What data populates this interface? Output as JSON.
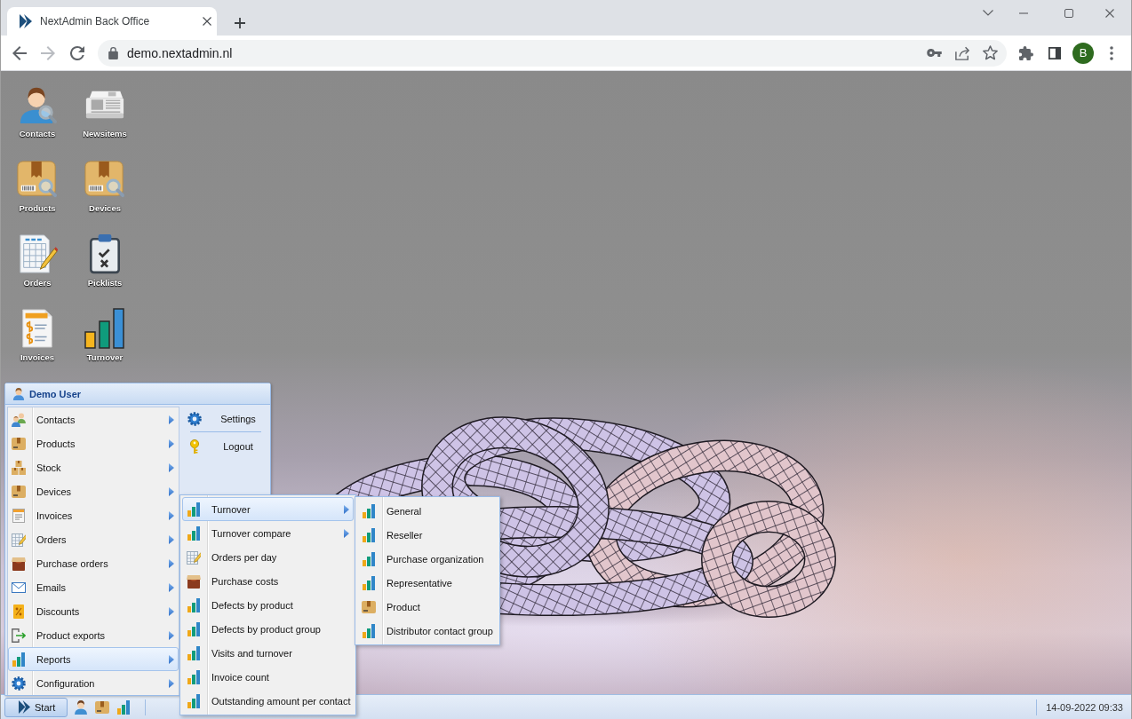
{
  "browser": {
    "tabs": [
      {
        "title": "NextAdmin Back Office",
        "selected": true
      }
    ],
    "navigation": {
      "back_disabled": false,
      "forward_disabled": true
    },
    "address": "demo.nextadmin.nl",
    "profile_initial": "B"
  },
  "desktop": {
    "shortcuts": [
      {
        "label": "Contacts",
        "kind": "contacts"
      },
      {
        "label": "Newsitems",
        "kind": "news"
      },
      {
        "label": "Products",
        "kind": "product"
      },
      {
        "label": "Devices",
        "kind": "product"
      },
      {
        "label": "Orders",
        "kind": "orders"
      },
      {
        "label": "Picklists",
        "kind": "picklist"
      },
      {
        "label": "Invoices",
        "kind": "invoice"
      },
      {
        "label": "Turnover",
        "kind": "chart"
      }
    ]
  },
  "start_menu": {
    "user": "Demo User",
    "items": [
      {
        "label": "Contacts",
        "kind": "contacts",
        "submenu": true,
        "selected": false
      },
      {
        "label": "Products",
        "kind": "box",
        "submenu": true,
        "selected": false
      },
      {
        "label": "Stock",
        "kind": "boxes",
        "submenu": true,
        "selected": false
      },
      {
        "label": "Devices",
        "kind": "box",
        "submenu": true,
        "selected": false
      },
      {
        "label": "Invoices",
        "kind": "invoice",
        "submenu": true,
        "selected": false
      },
      {
        "label": "Orders",
        "kind": "orders",
        "submenu": true,
        "selected": false
      },
      {
        "label": "Purchase orders",
        "kind": "purchase",
        "submenu": true,
        "selected": false
      },
      {
        "label": "Emails",
        "kind": "mail",
        "submenu": true,
        "selected": false
      },
      {
        "label": "Discounts",
        "kind": "discount",
        "submenu": true,
        "selected": false
      },
      {
        "label": "Product exports",
        "kind": "export",
        "submenu": true,
        "selected": false
      },
      {
        "label": "Reports",
        "kind": "chart",
        "submenu": true,
        "selected": true
      },
      {
        "label": "Configuration",
        "kind": "gear",
        "submenu": true,
        "selected": false
      }
    ],
    "side_items": [
      {
        "label": "Settings",
        "kind": "gear"
      },
      {
        "label": "Logout",
        "kind": "key"
      }
    ]
  },
  "submenus": [
    {
      "items": [
        {
          "label": "Turnover",
          "kind": "chart",
          "submenu": true,
          "selected": true
        },
        {
          "label": "Turnover compare",
          "kind": "chart",
          "submenu": true,
          "selected": false
        },
        {
          "label": "Orders per day",
          "kind": "orders",
          "submenu": false,
          "selected": false
        },
        {
          "label": "Purchase costs",
          "kind": "purchase",
          "submenu": false,
          "selected": false
        },
        {
          "label": "Defects by product",
          "kind": "chart",
          "submenu": false,
          "selected": false
        },
        {
          "label": "Defects by product group",
          "kind": "chart",
          "submenu": false,
          "selected": false
        },
        {
          "label": "Visits and turnover",
          "kind": "chart",
          "submenu": false,
          "selected": false
        },
        {
          "label": "Invoice count",
          "kind": "chart",
          "submenu": false,
          "selected": false
        },
        {
          "label": "Outstanding amount per contact",
          "kind": "chart",
          "submenu": false,
          "selected": false
        }
      ]
    },
    {
      "items": [
        {
          "label": "General",
          "kind": "chart",
          "submenu": false,
          "selected": false
        },
        {
          "label": "Reseller",
          "kind": "chart",
          "submenu": false,
          "selected": false
        },
        {
          "label": "Purchase organization",
          "kind": "chart",
          "submenu": false,
          "selected": false
        },
        {
          "label": "Representative",
          "kind": "chart",
          "submenu": false,
          "selected": false
        },
        {
          "label": "Product",
          "kind": "box",
          "submenu": false,
          "selected": false
        },
        {
          "label": "Distributor contact group",
          "kind": "chart",
          "submenu": false,
          "selected": false
        }
      ]
    }
  ],
  "taskbar": {
    "start_label": "Start",
    "clock": "14-09-2022 09:33"
  }
}
